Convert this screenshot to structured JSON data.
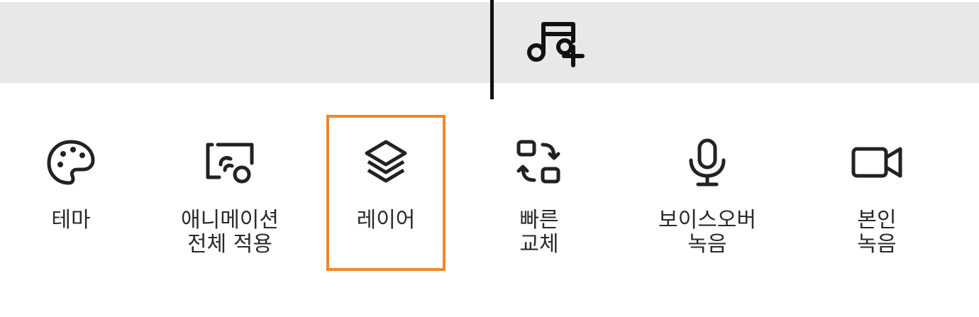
{
  "colors": {
    "strip": "#e8e8e8",
    "highlight": "#f0872c",
    "icon": "#222222"
  },
  "toolbar": {
    "add_music_icon": "music-plus-icon",
    "items": [
      {
        "label": "테마",
        "icon": "palette-icon"
      },
      {
        "label": "애니메이션\n전체 적용",
        "icon": "image-transition-icon"
      },
      {
        "label": "레이어",
        "icon": "layers-icon",
        "selected": true
      },
      {
        "label": "빠른\n교체",
        "icon": "swap-icon"
      },
      {
        "label": "보이스오버\n녹음",
        "icon": "microphone-icon"
      },
      {
        "label": "본인\n녹음",
        "icon": "video-camera-icon"
      }
    ]
  }
}
